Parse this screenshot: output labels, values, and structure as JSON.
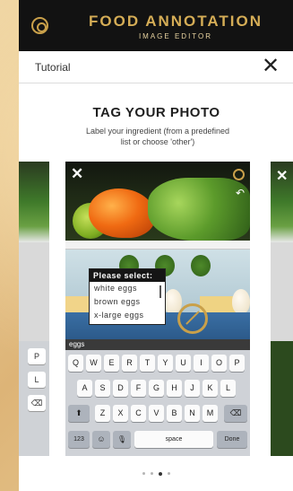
{
  "app": {
    "title": "FOOD ANNOTATION",
    "subtitle": "IMAGE EDITOR"
  },
  "header": {
    "title": "Tutorial",
    "close": "✕"
  },
  "slide": {
    "title": "TAG YOUR PHOTO",
    "description": "Label your ingredient (from a predefined list or choose 'other')"
  },
  "card": {
    "close": "✕",
    "undo": "↶",
    "dropdown": {
      "title": "Please select:",
      "options": [
        "white eggs",
        "brown eggs",
        "x-large eggs"
      ]
    },
    "tag_input": "eggs"
  },
  "keyboard": {
    "row1": [
      "Q",
      "W",
      "E",
      "R",
      "T",
      "Y",
      "U",
      "I",
      "O",
      "P"
    ],
    "row2": [
      "A",
      "S",
      "D",
      "F",
      "G",
      "H",
      "J",
      "K",
      "L"
    ],
    "row3": [
      "⬆",
      "Z",
      "X",
      "C",
      "V",
      "B",
      "N",
      "M",
      "⌫"
    ],
    "row4": [
      "123",
      "☺",
      "🎙",
      "space",
      "Done"
    ]
  },
  "side_left": {
    "keys": [
      "P",
      "L",
      "⌫"
    ]
  },
  "side_right": {
    "close": "✕"
  },
  "pager": {
    "count": 4,
    "active_index": 2
  }
}
